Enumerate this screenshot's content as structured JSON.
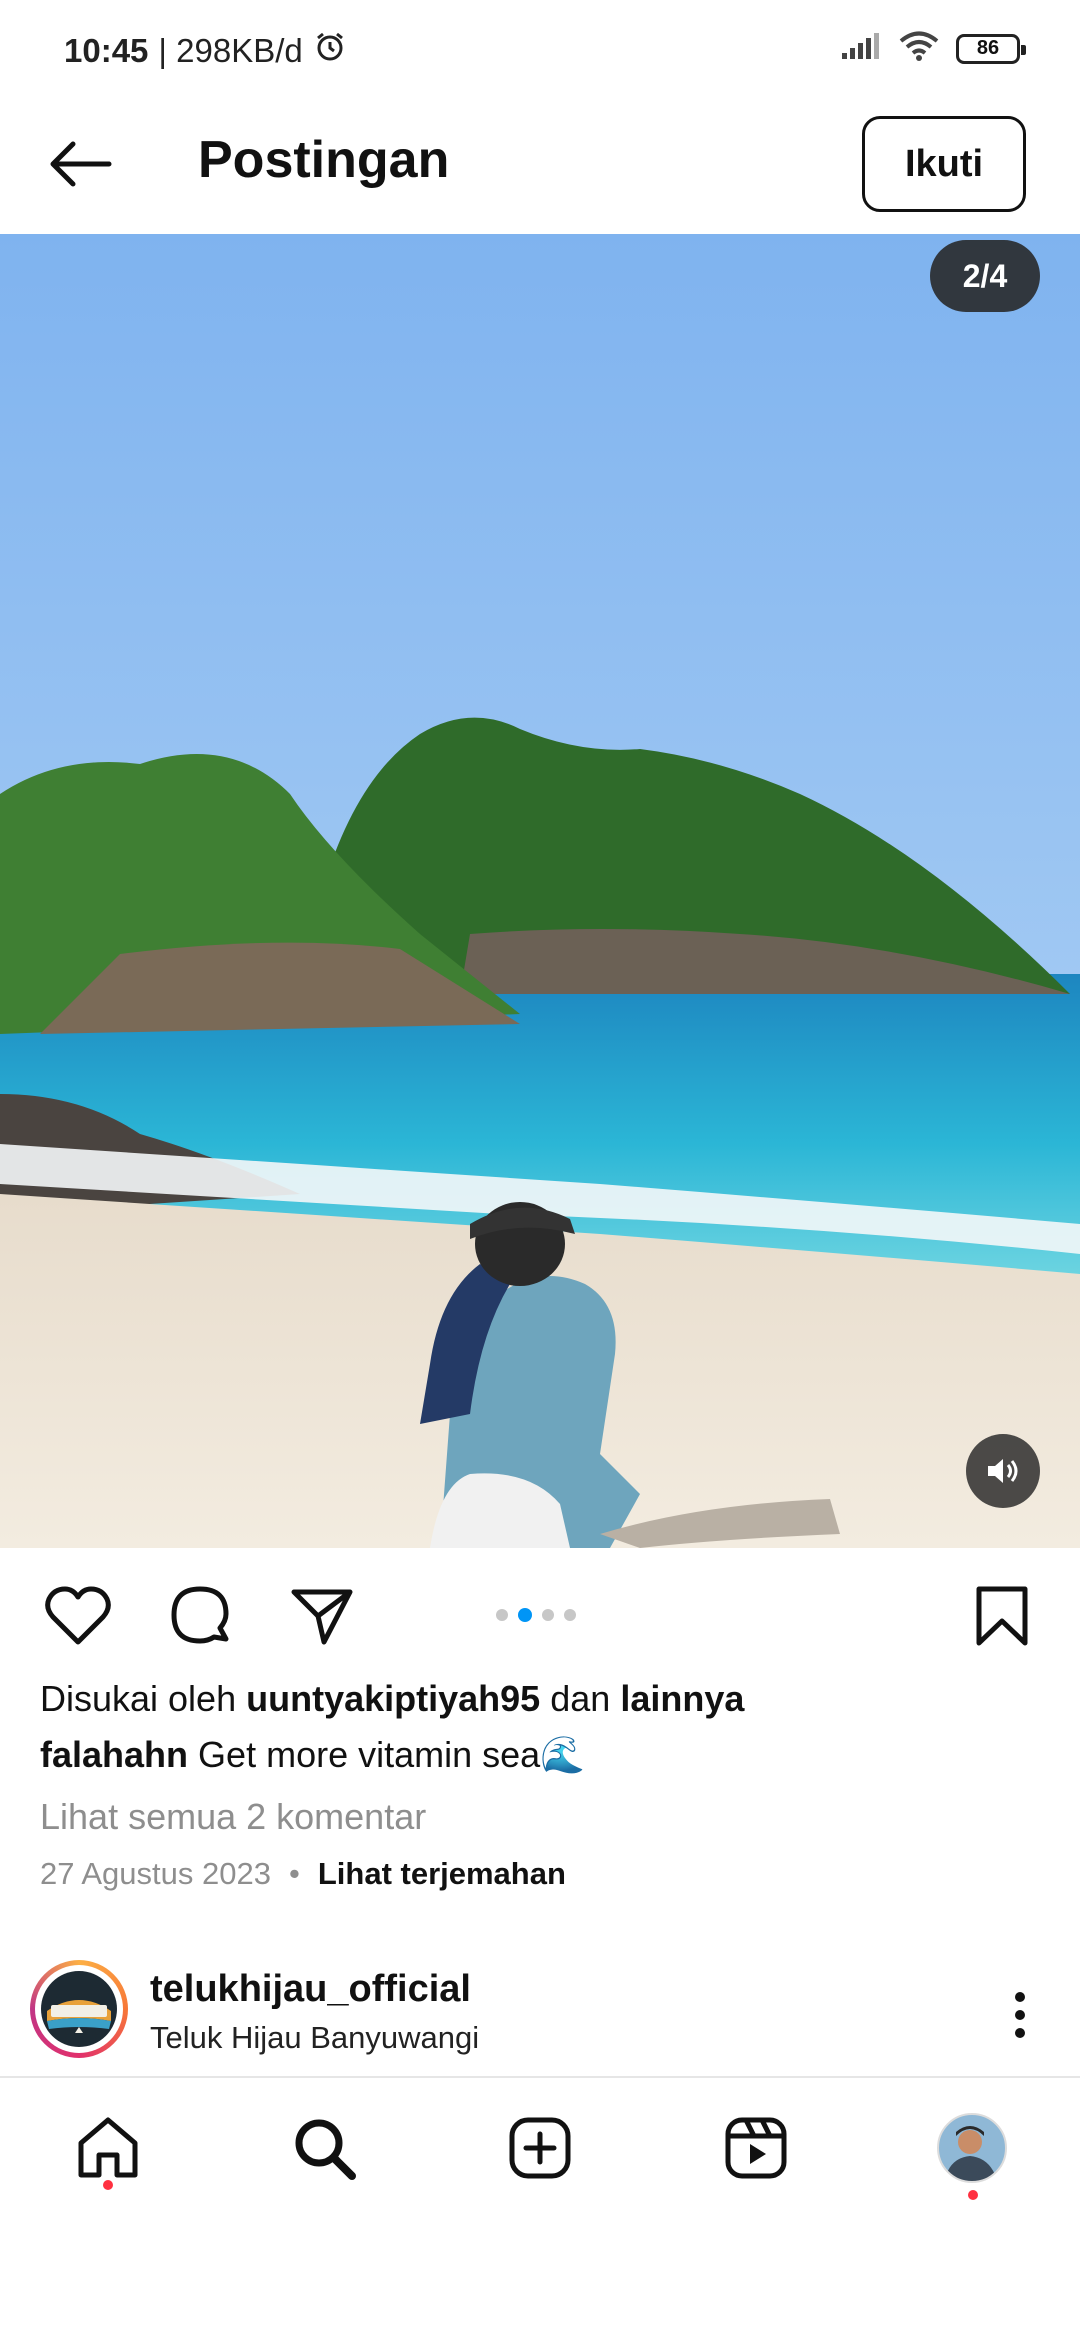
{
  "status_bar": {
    "time": "10:45",
    "data_rate": "| 298KB/d",
    "battery": "86",
    "icons": [
      "alarm-icon",
      "signal-icon",
      "wifi-icon",
      "battery-icon"
    ]
  },
  "header": {
    "title": "Postingan",
    "follow_label": "Ikuti",
    "back_icon": "arrow-left-icon"
  },
  "post": {
    "counter": "2/4",
    "image_subject": "beach-photo",
    "sound_icon": "speaker-icon",
    "carousel": {
      "count": 4,
      "active_index": 1
    }
  },
  "actions": {
    "icons": [
      "heart-icon",
      "comment-icon",
      "share-icon",
      "bookmark-icon"
    ]
  },
  "likes": {
    "prefix": "Disukai oleh",
    "user": "uuntyakiptiyah95",
    "joiner": "dan",
    "others": "lainnya"
  },
  "caption": {
    "username": "falahahn",
    "text": "Get more vitamin sea🌊"
  },
  "comments_link": "Lihat semua 2 komentar",
  "meta": {
    "date": "27 Agustus 2023",
    "separator": "•",
    "translate": "Lihat terjemahan"
  },
  "suggested_account": {
    "username": "telukhijau_official",
    "subtitle": "Teluk Hijau Banyuwangi",
    "avatar_text": "GREEN BAY",
    "more_icon": "more-vertical-icon"
  },
  "bottom_nav": {
    "items": [
      "home-icon",
      "search-icon",
      "add-icon",
      "reels-icon",
      "profile-avatar"
    ]
  },
  "colors": {
    "accent_blue": "#0095f6",
    "notification_red": "#ff3040",
    "text_secondary": "#8e8e8e"
  }
}
